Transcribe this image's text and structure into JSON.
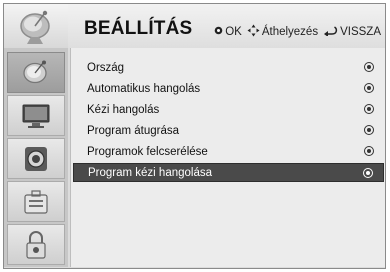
{
  "header": {
    "title": "BEÁLLÍTÁS",
    "hints": [
      {
        "icon": "ok-button-icon",
        "label": "OK"
      },
      {
        "icon": "navigate-arrows-icon",
        "label": "Áthelyezés"
      },
      {
        "icon": "back-icon",
        "label": "VISSZA"
      }
    ]
  },
  "sidebar": {
    "items": [
      {
        "icon": "satellite-dish-icon",
        "active": true
      },
      {
        "icon": "tv-screen-icon",
        "active": false
      },
      {
        "icon": "speaker-icon",
        "active": false
      },
      {
        "icon": "toolbox-icon",
        "active": false
      },
      {
        "icon": "lock-icon",
        "active": false
      }
    ]
  },
  "menu": {
    "items": [
      {
        "label": "Ország",
        "selected": false
      },
      {
        "label": "Automatikus hangolás",
        "selected": false
      },
      {
        "label": "Kézi hangolás",
        "selected": false
      },
      {
        "label": "Program átugrása",
        "selected": false
      },
      {
        "label": "Programok felcserélése",
        "selected": false
      },
      {
        "label": "Program kézi hangolása",
        "selected": true
      }
    ]
  },
  "colors": {
    "selected_bg": "#4a4a4a",
    "panel_bg": "#ececec",
    "sidebar_bg": "#c7c7c7"
  }
}
